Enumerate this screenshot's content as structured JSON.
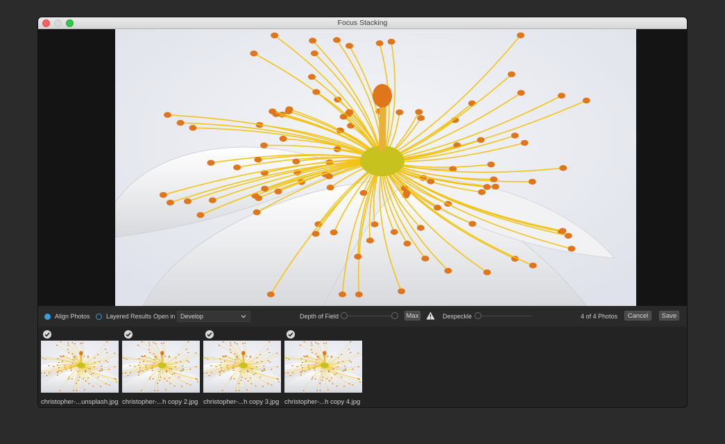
{
  "window": {
    "title": "Focus Stacking"
  },
  "controls": {
    "align_photos": "Align Photos",
    "layered_results": "Layered Results",
    "open_in_label": "Open in",
    "open_in_value": "Develop",
    "depth_of_field": "Depth of Field",
    "max_button": "Max",
    "despeckle": "Despeckle",
    "photo_count": "4 of 4 Photos",
    "cancel_button": "Cancel",
    "save_button": "Save"
  },
  "thumbnails": [
    {
      "label": "christopher-...unsplash.jpg"
    },
    {
      "label": "christopher-...h copy 2.jpg"
    },
    {
      "label": "christopher-...h copy 3.jpg"
    },
    {
      "label": "christopher-...h copy 4.jpg"
    }
  ],
  "colors": {
    "accent": "#3b9fd6",
    "stamen": "#f2c318",
    "anther": "#e0761c"
  },
  "icons": {
    "warning": "warning-icon",
    "check": "checkmark-icon",
    "dropdown": "chevron-down-icon"
  }
}
